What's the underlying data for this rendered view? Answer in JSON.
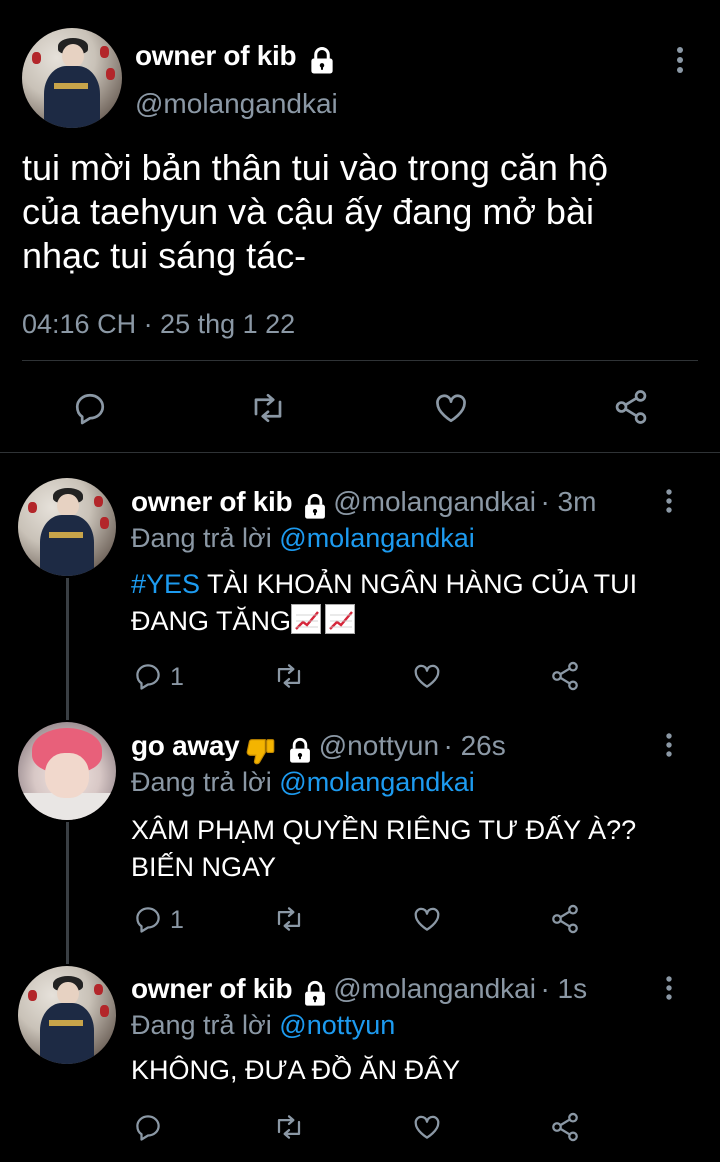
{
  "main_tweet": {
    "name": "owner of kib",
    "handle": "@molangandkai",
    "text_line1": "tui mời bản thân tui vào trong căn hộ",
    "text_line2": "của taehyun và cậu ấy đang mở bài",
    "text_line3": "nhạc tui sáng tác-",
    "timestamp": "04:16 CH · 25 thg 1 22"
  },
  "replies": [
    {
      "name": "owner of kib",
      "handle": "@molangandkai",
      "time": "· 3m",
      "replying_label": "Đang trả lời",
      "replying_to": "@molangandkai",
      "hashtag": "#YES",
      "text_line1": " TÀI KHOẢN NGÂN HÀNG CỦA TUI",
      "text_line2": "ĐANG TĂNG",
      "reply_count": "1"
    },
    {
      "name": "go away",
      "handle": "@nottyun",
      "time": "· 26s",
      "replying_label": "Đang trả lời",
      "replying_to": "@molangandkai",
      "text_line1": "XÂM PHẠM QUYỀN RIÊNG TƯ ĐẤY À??",
      "text_line2": "BIẾN NGAY",
      "reply_count": "1"
    },
    {
      "name": "owner of kib",
      "handle": "@molangandkai",
      "time": "· 1s",
      "replying_label": "Đang trả lời",
      "replying_to": "@nottyun",
      "text_line1": "KHÔNG, ĐƯA ĐỒ ĂN ĐÂY"
    }
  ],
  "icons": {
    "more": "more-vertical-icon",
    "lock": "lock-icon",
    "reply": "reply-icon",
    "retweet": "retweet-icon",
    "like": "heart-icon",
    "share": "share-icon",
    "thumbs_down": "thumbs-down-emoji",
    "chart": "chart-increasing-emoji"
  },
  "colors": {
    "background": "#000000",
    "text": "#ffffff",
    "secondary": "#8b98a5",
    "link": "#1d9bf0",
    "divider": "#2f3336"
  }
}
